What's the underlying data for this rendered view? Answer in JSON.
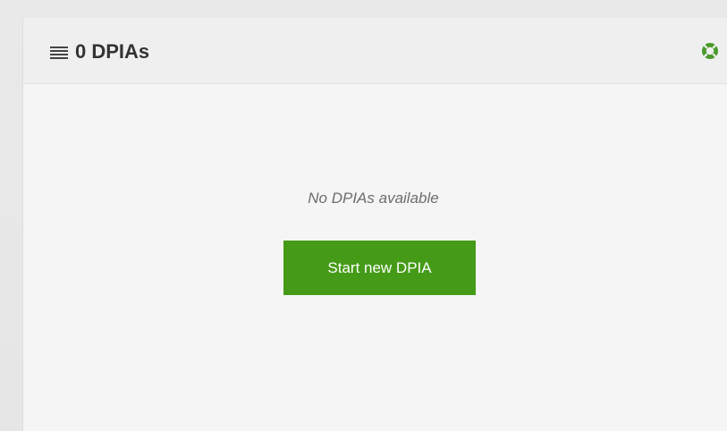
{
  "header": {
    "title": "0 DPIAs",
    "menu_icon": "hamburger-menu-icon",
    "help_icon": "lifebuoy-icon"
  },
  "main": {
    "empty_message": "No DPIAs available",
    "start_button_label": "Start new DPIA"
  },
  "colors": {
    "accent": "#459b18",
    "header_bg": "#efefef",
    "panel_bg": "#f5f5f5"
  }
}
